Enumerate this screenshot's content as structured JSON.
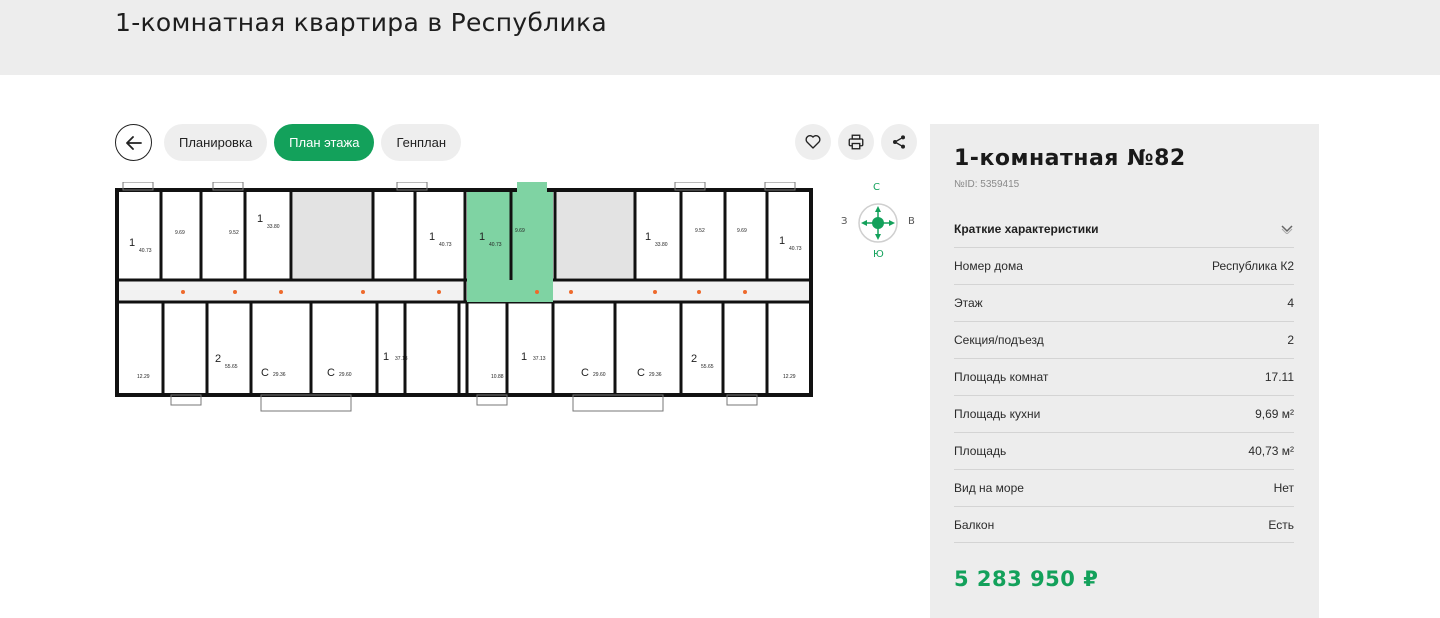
{
  "page": {
    "title": "1-комнатная квартира в Республика"
  },
  "toolbar": {
    "tabs": [
      {
        "label": "Планировка",
        "active": false
      },
      {
        "label": "План этажа",
        "active": true
      },
      {
        "label": "Генплан",
        "active": false
      }
    ],
    "icons": [
      "arrow-left-icon",
      "heart-icon",
      "printer-icon",
      "share-icon"
    ]
  },
  "compass": {
    "north": "С",
    "south": "Ю",
    "west": "З",
    "east": "В"
  },
  "floor_plan": {
    "highlight_color": "#7fd3a3",
    "wall_color": "#111111",
    "labels": {
      "u1": {
        "rooms": "1",
        "area": "40.73"
      },
      "u2": {
        "rooms": "",
        "area": "9.69"
      },
      "u3": {
        "rooms": "",
        "area": "9.52"
      },
      "u4": {
        "rooms": "1",
        "area": "33.80"
      },
      "u5": {
        "rooms": "1",
        "area": "40.73"
      },
      "u6": {
        "rooms": "1",
        "area": "40.73"
      },
      "u7": {
        "rooms": "",
        "area": "9.69"
      },
      "u8": {
        "rooms": "1",
        "area": "33.80"
      },
      "u9": {
        "rooms": "",
        "area": "9.52"
      },
      "u10": {
        "rooms": "",
        "area": "9.69"
      },
      "u11": {
        "rooms": "1",
        "area": "40.73"
      },
      "l1": {
        "rooms": "",
        "area": "12.29"
      },
      "l2": {
        "rooms": "2",
        "area": "55.65"
      },
      "l3": {
        "rooms": "C",
        "area": "29.36"
      },
      "l4": {
        "rooms": "C",
        "area": "29.60"
      },
      "l5": {
        "rooms": "1",
        "area": "37.13"
      },
      "l6": {
        "rooms": "",
        "area": "10.88"
      },
      "l7": {
        "rooms": "1",
        "area": "37.13"
      },
      "l8": {
        "rooms": "C",
        "area": "29.60"
      },
      "l9": {
        "rooms": "C",
        "area": "29.36"
      },
      "l10": {
        "rooms": "2",
        "area": "55.65"
      },
      "l11": {
        "rooms": "",
        "area": "12.29"
      }
    }
  },
  "card": {
    "title": "1-комнатная №82",
    "id_label": "№ID: 5359415",
    "specs_heading": "Краткие характеристики",
    "specs": [
      {
        "label": "Номер дома",
        "value": "Республика К2"
      },
      {
        "label": "Этаж",
        "value": "4"
      },
      {
        "label": "Секция/подъезд",
        "value": "2"
      },
      {
        "label": "Площадь комнат",
        "value": "17.11"
      },
      {
        "label": "Площадь кухни",
        "value": "9,69 м²"
      },
      {
        "label": "Площадь",
        "value": "40,73 м²"
      },
      {
        "label": "Вид на море",
        "value": "Нет"
      },
      {
        "label": "Балкон",
        "value": "Есть"
      }
    ],
    "price": "5 283 950 ₽"
  },
  "colors": {
    "accent": "#13a15b",
    "header_bg": "#ededed",
    "card_bg": "#ededed"
  }
}
